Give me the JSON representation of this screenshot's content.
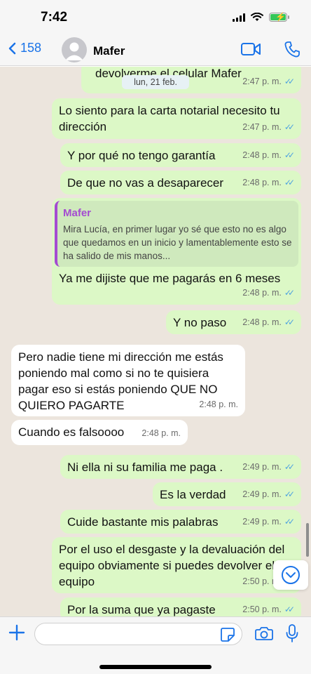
{
  "status": {
    "time": "7:42"
  },
  "header": {
    "back_count": "158",
    "contact_name": "Mafer",
    "icons": [
      "chevron-left-icon",
      "avatar-icon",
      "video-camera-icon",
      "phone-icon"
    ]
  },
  "chat": {
    "date_label": "lun, 21 feb.",
    "messages": [
      {
        "text": "devolverme el celular Mafer",
        "time": "2:47 p. m.",
        "dir": "out"
      },
      {
        "text": "Lo siento para la carta notarial necesito tu dirección",
        "time": "2:47 p. m.",
        "dir": "out"
      },
      {
        "text": "Y por qué no tengo garantía",
        "time": "2:48 p. m.",
        "dir": "out"
      },
      {
        "text": "De que no vas a desaparecer",
        "time": "2:48 p. m.",
        "dir": "out"
      },
      {
        "quote_author": "Mafer",
        "quote_text": "Mira Lucía, en primer lugar yo sé que esto no es algo que quedamos en un inicio y lamentablemente esto se ha salido de mis manos...",
        "text": "Ya me dijiste que me pagarás en 6 meses",
        "time": "2:48 p. m.",
        "dir": "out"
      },
      {
        "text": "Y no paso",
        "time": "2:48 p. m.",
        "dir": "out"
      },
      {
        "text": "Pero nadie tiene mi dirección me estás poniendo mal como si no te quisiera pagar eso si estás poniendo QUE NO QUIERO PAGARTE",
        "time": "2:48 p. m.",
        "dir": "in"
      },
      {
        "text": "Cuando es falsoooo",
        "time": "2:48 p. m.",
        "dir": "in"
      },
      {
        "text": "Ni ella ni su familia me paga .",
        "time": "2:49 p. m.",
        "dir": "out"
      },
      {
        "text": "Es la verdad",
        "time": "2:49 p. m.",
        "dir": "out"
      },
      {
        "text": "Cuide bastante mis palabras",
        "time": "2:49 p. m.",
        "dir": "out"
      },
      {
        "text": "Por el uso el desgaste y la devaluación del equipo obviamente si puedes devolver el equipo",
        "time": "2:50 p. m.",
        "dir": "out"
      },
      {
        "text": "Por la suma que ya pagaste",
        "time": "2:50 p. m.",
        "dir": "out"
      }
    ],
    "read_ticks": "✓✓"
  },
  "composer": {
    "input_value": "",
    "icons": [
      "plus-icon",
      "sticker-icon",
      "camera-icon",
      "microphone-icon"
    ]
  },
  "colors": {
    "outgoing_bubble": "#dcf8c6",
    "incoming_bubble": "#ffffff",
    "chat_background": "#ece5dd",
    "accent": "#1a73e8",
    "quote_accent": "#a44bd1",
    "battery": "#34c759"
  }
}
